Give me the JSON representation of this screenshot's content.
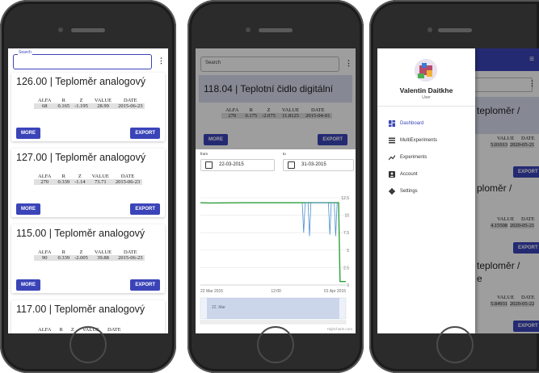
{
  "phone1": {
    "search_label": "Search",
    "cards": [
      {
        "title": "126.00 | Teploměr analogový",
        "alfa": "68",
        "r": "0.165",
        "z": "-1.195",
        "value": "28.99",
        "date": "2015-06-23"
      },
      {
        "title": "127.00 | Teploměr analogový",
        "alfa": "270",
        "r": "0.339",
        "z": "-1.14",
        "value": "73.71",
        "date": "2015-06-23"
      },
      {
        "title": "115.00 | Teploměr analogový",
        "alfa": "90",
        "r": "0.339",
        "z": "-2.005",
        "value": "39.88",
        "date": "2015-06-23"
      },
      {
        "title": "117.00 | Teploměr analogový"
      }
    ],
    "headers": {
      "alfa": "ALFA",
      "r": "R",
      "z": "Z",
      "value": "VALUE",
      "date": "DATE"
    },
    "more_label": "MORE",
    "export_label": "EXPORT"
  },
  "phone2": {
    "search_placeholder": "Search",
    "card": {
      "title": "118.04 | Teplotní čidlo digitální",
      "alfa": "270",
      "r": "0.175",
      "z": "-2.075",
      "value": "11.8125",
      "date": "2015-04-01"
    },
    "from_label": "from",
    "to_label": "to",
    "from_date": "22-03-2015",
    "to_date": "31-03-2015",
    "credit": "Highcharts.com",
    "nav_label": "22. Mar",
    "chart_data": {
      "type": "line",
      "title": "",
      "x_ticks": [
        "22 Mar 2015",
        "12:00",
        "01 Apr 2015"
      ],
      "y_ticks": [
        "0",
        "2.5",
        "5",
        "7.5",
        "10",
        "12.5"
      ],
      "ylim": [
        0,
        12.5
      ],
      "series": [
        {
          "color": "#2e9e3a",
          "x": [
            0,
            0.06,
            0.3,
            0.55,
            0.7,
            0.85,
            0.95,
            0.96,
            1.0
          ],
          "values": [
            11.8,
            11.75,
            11.8,
            11.8,
            11.8,
            11.8,
            11.8,
            0.5,
            0.5
          ]
        },
        {
          "color": "#4a8fd0",
          "x": [
            0.7,
            0.71,
            0.72,
            0.74,
            0.75,
            0.76,
            0.88,
            0.89,
            0.9,
            0.92,
            0.93,
            0.94
          ],
          "values": [
            11.8,
            7.5,
            11.8,
            11.8,
            7.0,
            11.8,
            11.8,
            7.2,
            11.8,
            11.8,
            7.0,
            11.8
          ]
        }
      ]
    }
  },
  "phone3": {
    "user_name": "Valentin Daitkhe",
    "user_role": "User",
    "nav": [
      {
        "label": "Dashboard",
        "icon": "dashboard-icon",
        "active": true
      },
      {
        "label": "MultiExperiments",
        "icon": "list-icon",
        "active": false
      },
      {
        "label": "Experiments",
        "icon": "trend-icon",
        "active": false
      },
      {
        "label": "Account",
        "icon": "account-icon",
        "active": false
      },
      {
        "label": "Settings",
        "icon": "gear-icon",
        "active": false
      }
    ],
    "bg_cards": [
      {
        "title_a": "teploměr /",
        "value": "5.01013",
        "date": "2020-05-21"
      },
      {
        "title_a": "ploměr /",
        "value": "4.15508",
        "date": "2020-05-21"
      },
      {
        "title_a": "teploměr /",
        "title_b": "e",
        "value": "5.84931",
        "date": "2020-05-22"
      }
    ],
    "value_header": "VALUE",
    "date_header": "DATE",
    "export_label": "EXPORT",
    "accent": "#3a44b8",
    "active_color": "#3a44b8"
  }
}
